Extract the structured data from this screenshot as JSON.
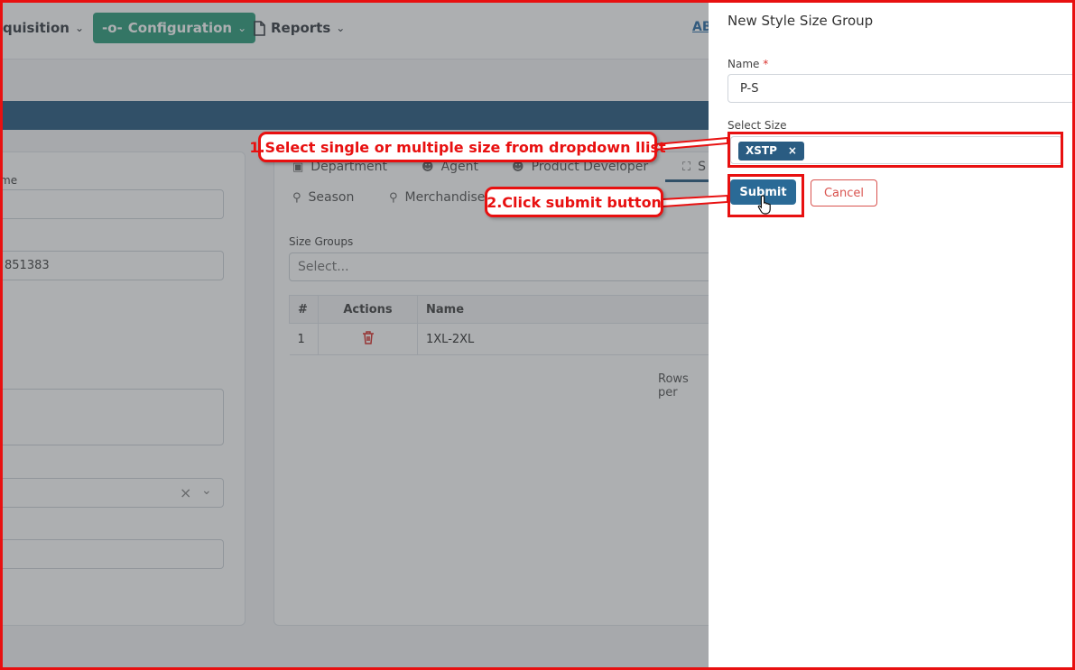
{
  "topnav": {
    "items": [
      {
        "label": "quisition",
        "icon": "chevron-down-icon"
      },
      {
        "label": "Configuration",
        "icon": "connection-icon"
      },
      {
        "label": "Reports",
        "icon": "document-icon"
      }
    ],
    "account_abbrev": "AB",
    "active_color": "#2f9e7d"
  },
  "left_panel": {
    "label_name_fragment": "me",
    "value_number_fragment": "851383"
  },
  "right_panel": {
    "tabs": [
      {
        "label": "Department",
        "icon": "cube-icon"
      },
      {
        "label": "Agent",
        "icon": "user-icon"
      },
      {
        "label": "Product Developer",
        "icon": "user-icon"
      },
      {
        "label": "S",
        "icon": "expand-icon"
      },
      {
        "label": "Season",
        "icon": "location-pin-icon"
      },
      {
        "label": "Merchandise",
        "icon": "location-pin-icon"
      }
    ],
    "size_groups_label": "Size Groups",
    "size_groups_placeholder": "Select...",
    "table": {
      "headers": [
        "#",
        "Actions",
        "Name"
      ],
      "rows": [
        {
          "index": "1",
          "action_icon": "trash-icon",
          "name": "1XL-2XL"
        }
      ]
    },
    "rows_per_page_fragment": "Rows per"
  },
  "drawer": {
    "title": "New Style Size Group",
    "name_label": "Name",
    "name_required_mark": "*",
    "name_value": "P-S",
    "select_size_label": "Select Size",
    "selected_sizes": [
      "XSTP"
    ],
    "chip_remove": "×",
    "submit_label": "Submit",
    "cancel_label": "Cancel"
  },
  "annotations": {
    "step1": "1.Select single or multiple size from dropdown llist",
    "step2": "2.Click  submit button",
    "color": "#e81010"
  }
}
